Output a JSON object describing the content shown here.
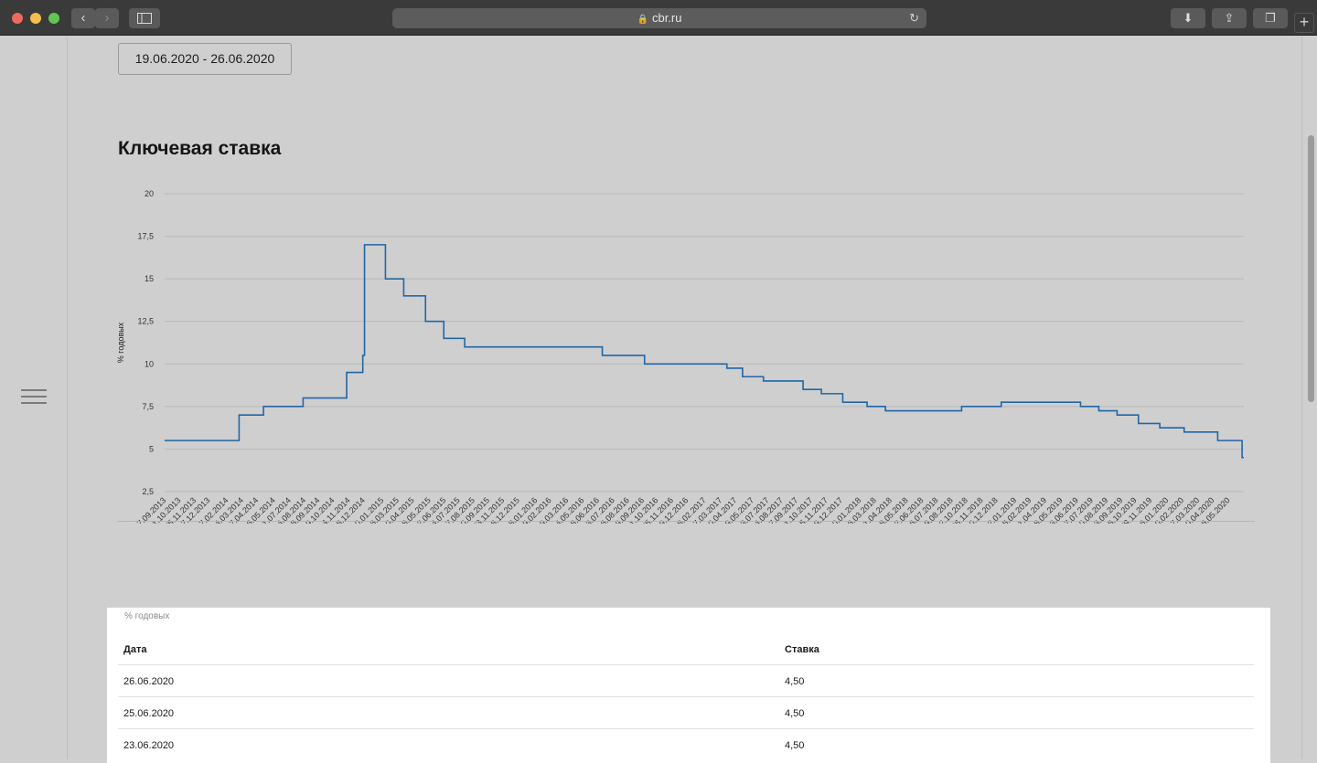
{
  "browser": {
    "url": "cbr.ru"
  },
  "date_range": "19.06.2020 - 26.06.2020",
  "chart_title": "Ключевая ставка",
  "chart_data": {
    "type": "line",
    "title": "Ключевая ставка",
    "ylabel": "% годовых",
    "ylim": [
      2.5,
      20
    ],
    "yticks": [
      "2,5",
      "5",
      "7,5",
      "10",
      "12,5",
      "15",
      "17,5",
      "20"
    ],
    "ytick_values": [
      2.5,
      5,
      7.5,
      10,
      12.5,
      15,
      17.5,
      20
    ],
    "xticks": [
      "17.09.2013",
      "21.10.2013",
      "25.11.2013",
      "27.12.2013",
      "07.02.2014",
      "14.03.2014",
      "17.04.2014",
      "26.05.2014",
      "01.07.2014",
      "04.08.2014",
      "05.09.2014",
      "09.10.2014",
      "14.11.2014",
      "18.12.2014",
      "30.01.2015",
      "06.03.2015",
      "10.04.2015",
      "18.05.2015",
      "22.06.2015",
      "24.07.2015",
      "27.08.2015",
      "30.09.2015",
      "03.11.2015",
      "08.12.2015",
      "18.01.2016",
      "19.02.2016",
      "29.03.2016",
      "04.05.2016",
      "08.06.2016",
      "13.07.2016",
      "16.08.2016",
      "19.09.2016",
      "21.10.2016",
      "25.11.2016",
      "29.12.2016",
      "08.02.2017",
      "17.03.2017",
      "20.04.2017",
      "29.05.2017",
      "03.07.2017",
      "04.08.2017",
      "07.09.2017",
      "11.10.2017",
      "15.11.2017",
      "19.12.2017",
      "30.01.2018",
      "06.03.2018",
      "11.04.2018",
      "18.05.2018",
      "22.06.2018",
      "26.07.2018",
      "29.08.2018",
      "02.10.2018",
      "06.11.2018",
      "10.12.2018",
      "22.01.2019",
      "25.02.2019",
      "01.04.2019",
      "08.05.2019",
      "13.06.2019",
      "17.07.2019",
      "20.08.2019",
      "23.09.2019",
      "25.10.2019",
      "29.11.2019",
      "06.01.2020",
      "10.02.2020",
      "17.03.2020",
      "20.04.2020",
      "26.05.2020"
    ],
    "series": [
      {
        "color": "#2166a8",
        "points": [
          [
            "13.09.2013",
            5.5
          ],
          [
            "03.03.2014",
            7.0
          ],
          [
            "28.04.2014",
            7.5
          ],
          [
            "28.07.2014",
            8.0
          ],
          [
            "05.11.2014",
            9.5
          ],
          [
            "12.12.2014",
            10.5
          ],
          [
            "16.12.2014",
            17.0
          ],
          [
            "02.02.2015",
            15.0
          ],
          [
            "16.03.2015",
            14.0
          ],
          [
            "05.05.2015",
            12.5
          ],
          [
            "16.06.2015",
            11.5
          ],
          [
            "03.08.2015",
            11.0
          ],
          [
            "14.06.2016",
            10.5
          ],
          [
            "19.09.2016",
            10.0
          ],
          [
            "27.03.2017",
            9.75
          ],
          [
            "02.05.2017",
            9.25
          ],
          [
            "19.06.2017",
            9.0
          ],
          [
            "18.09.2017",
            8.5
          ],
          [
            "30.10.2017",
            8.25
          ],
          [
            "18.12.2017",
            7.75
          ],
          [
            "12.02.2018",
            7.5
          ],
          [
            "26.03.2018",
            7.25
          ],
          [
            "17.09.2018",
            7.5
          ],
          [
            "17.12.2018",
            7.75
          ],
          [
            "17.06.2019",
            7.5
          ],
          [
            "29.07.2019",
            7.25
          ],
          [
            "09.09.2019",
            7.0
          ],
          [
            "28.10.2019",
            6.5
          ],
          [
            "16.12.2019",
            6.25
          ],
          [
            "10.02.2020",
            6.0
          ],
          [
            "27.04.2020",
            5.5
          ],
          [
            "22.06.2020",
            4.5
          ],
          [
            "26.06.2020",
            4.5
          ]
        ]
      }
    ],
    "grid": true,
    "legend": "none"
  },
  "table": {
    "units_note": "% годовых",
    "headers": {
      "date": "Дата",
      "rate": "Ставка"
    },
    "rows": [
      {
        "date": "26.06.2020",
        "rate": "4,50"
      },
      {
        "date": "25.06.2020",
        "rate": "4,50"
      },
      {
        "date": "23.06.2020",
        "rate": "4,50"
      }
    ]
  }
}
